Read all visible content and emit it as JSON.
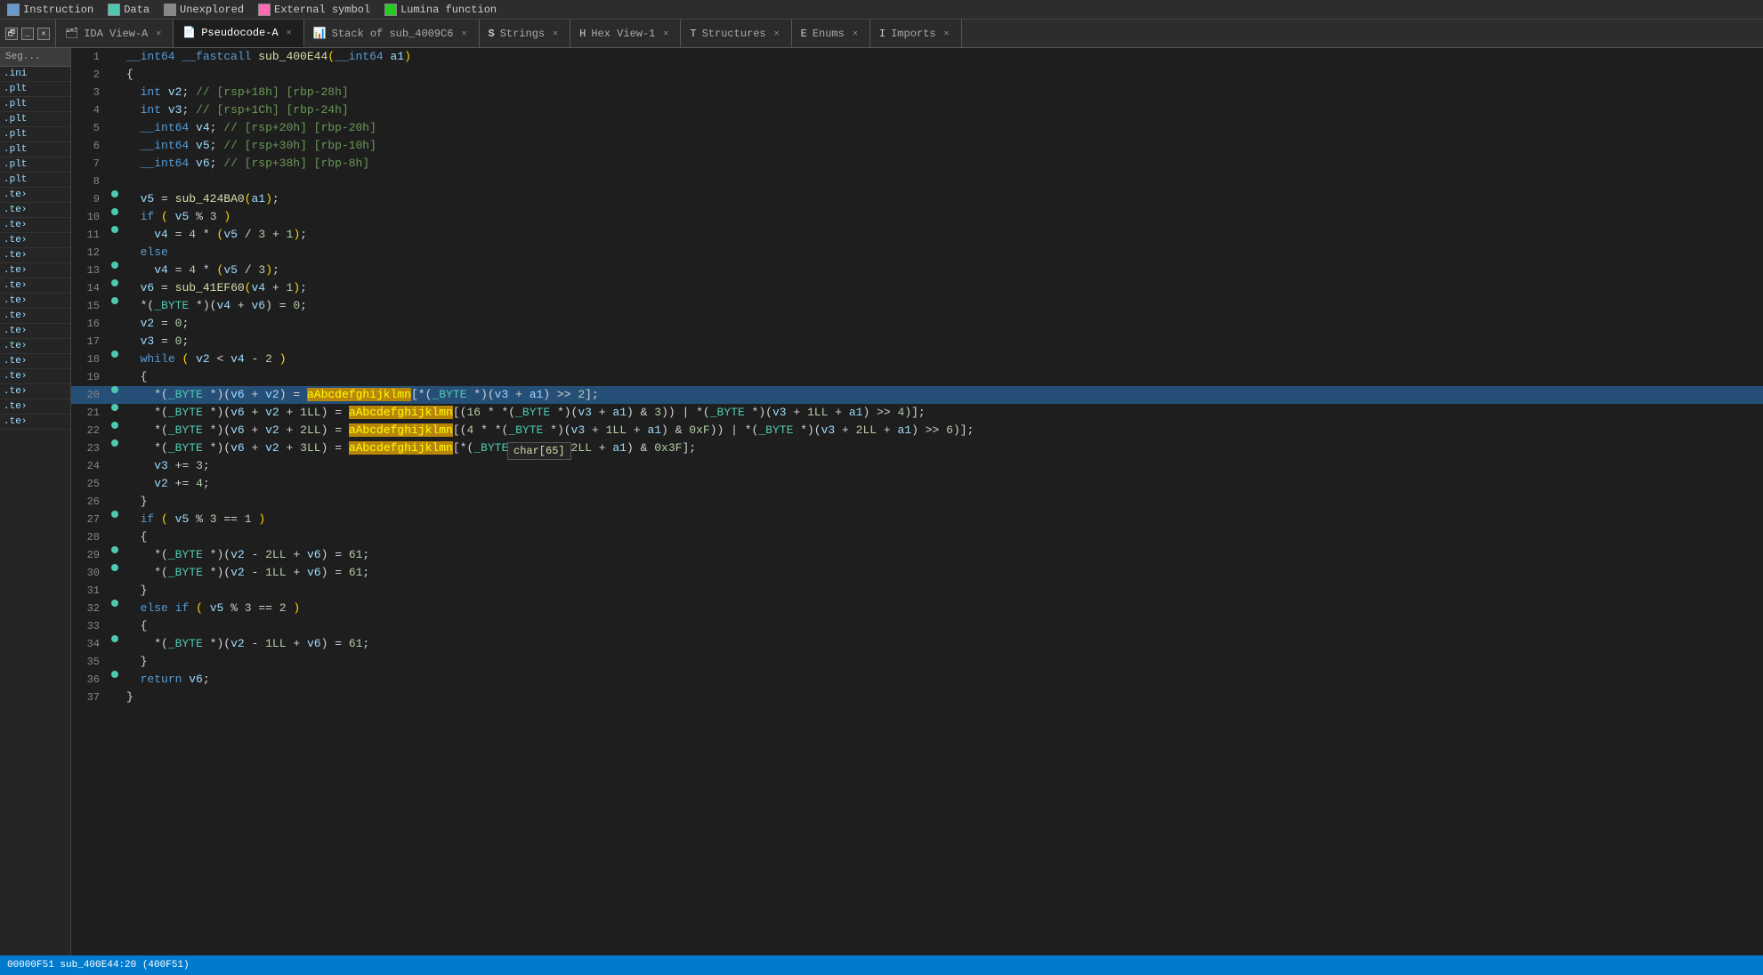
{
  "legend": {
    "items": [
      {
        "label": "Instruction",
        "color": "#6699cc",
        "type": "square"
      },
      {
        "label": "Data",
        "color": "#4ec9b0",
        "type": "square"
      },
      {
        "label": "Unexplored",
        "color": "#888888",
        "type": "square"
      },
      {
        "label": "External symbol",
        "color": "#ff69b4",
        "type": "square"
      },
      {
        "label": "Lumina function",
        "color": "#22cc22",
        "type": "square"
      }
    ]
  },
  "tabs": [
    {
      "label": "IDA View-A",
      "icon": "🗂",
      "active": false,
      "closable": true
    },
    {
      "label": "Pseudocode-A",
      "icon": "📄",
      "active": true,
      "closable": true
    },
    {
      "label": "Stack of sub_4009C6",
      "icon": "📊",
      "active": false,
      "closable": true
    },
    {
      "label": "Strings",
      "icon": "S",
      "active": false,
      "closable": true
    },
    {
      "label": "Hex View-1",
      "icon": "H",
      "active": false,
      "closable": true
    },
    {
      "label": "Structures",
      "icon": "T",
      "active": false,
      "closable": true
    },
    {
      "label": "Enums",
      "icon": "E",
      "active": false,
      "closable": true
    },
    {
      "label": "Imports",
      "icon": "I",
      "active": false,
      "closable": true
    }
  ],
  "sidebar": {
    "header": "Seg...",
    "items": [
      ".ini",
      ".plt",
      ".plt",
      ".plt",
      ".plt",
      ".plt",
      ".plt",
      ".plt",
      ".te›",
      ".te›",
      ".te›",
      ".te›",
      ".te›",
      ".te›",
      ".te›",
      ".te›",
      ".te›",
      ".te›",
      ".te›",
      ".te›",
      ".te›",
      ".te›",
      ".te›",
      ".te›"
    ]
  },
  "code": {
    "function_sig": "__int64 __fastcall sub_400E44(__int64 a1)",
    "lines": [
      {
        "num": 1,
        "dot": false,
        "text": "__int64 __fastcall sub_400E44(__int64 a1)",
        "type": "sig"
      },
      {
        "num": 2,
        "dot": false,
        "text": "{",
        "type": "normal"
      },
      {
        "num": 3,
        "dot": false,
        "text": "  int v2; // [rsp+18h] [rbp-28h]",
        "type": "comment"
      },
      {
        "num": 4,
        "dot": false,
        "text": "  int v3; // [rsp+1Ch] [rbp-24h]",
        "type": "comment"
      },
      {
        "num": 5,
        "dot": false,
        "text": "  __int64 v4; // [rsp+20h] [rbp-20h]",
        "type": "comment"
      },
      {
        "num": 6,
        "dot": false,
        "text": "  __int64 v5; // [rsp+30h] [rbp-10h]",
        "type": "comment"
      },
      {
        "num": 7,
        "dot": false,
        "text": "  __int64 v6; // [rsp+38h] [rbp-8h]",
        "type": "comment"
      },
      {
        "num": 8,
        "dot": false,
        "text": "",
        "type": "normal"
      },
      {
        "num": 9,
        "dot": true,
        "text": "  v5 = sub_424BA0(a1);",
        "type": "normal"
      },
      {
        "num": 10,
        "dot": true,
        "text": "  if ( v5 % 3 )",
        "type": "normal"
      },
      {
        "num": 11,
        "dot": true,
        "text": "    v4 = 4 * (v5 / 3 + 1);",
        "type": "normal"
      },
      {
        "num": 12,
        "dot": false,
        "text": "  else",
        "type": "normal"
      },
      {
        "num": 13,
        "dot": true,
        "text": "    v4 = 4 * (v5 / 3);",
        "type": "normal"
      },
      {
        "num": 14,
        "dot": true,
        "text": "  v6 = sub_41EF60(v4 + 1);",
        "type": "normal"
      },
      {
        "num": 15,
        "dot": true,
        "text": "  *(_BYTE *)(v4 + v6) = 0;",
        "type": "normal"
      },
      {
        "num": 16,
        "dot": false,
        "text": "  v2 = 0;",
        "type": "normal"
      },
      {
        "num": 17,
        "dot": false,
        "text": "  v3 = 0;",
        "type": "normal"
      },
      {
        "num": 18,
        "dot": true,
        "text": "  while ( v2 < v4 - 2 )",
        "type": "normal"
      },
      {
        "num": 19,
        "dot": false,
        "text": "  {",
        "type": "normal"
      },
      {
        "num": 20,
        "dot": true,
        "text": "    *(_BYTE *)(v6 + v2) = aAbcdefghijklmn[*(_BYTE *)(v3 + a1) >> 2];",
        "type": "highlight"
      },
      {
        "num": 21,
        "dot": true,
        "text": "    *(_BYTE *)(v6 + v2 + 1LL) = aAbcdefghijklmn[(16 * (*(_BYTE *)(v3 + a1) & 3)) | (*(_BYTE *)(v3 + 1LL + a1) >> 4)];",
        "type": "normal"
      },
      {
        "num": 22,
        "dot": true,
        "text": "    *(_BYTE *)(v6 + v2 + 2LL) = aAbcdefghijklmn[(4 * (*(_BYTE *)(v3 + 1LL + a1) & 0xF)) | (*(_BYTE *)(v3 + 2LL + a1) >> 6)];",
        "type": "normal"
      },
      {
        "num": 23,
        "dot": true,
        "text": "    *(_BYTE *)(v6 + v2 + 3LL) = aAbcdefghijklmn[*(_BYTE *)(v3 + 2LL + a1) & 0x3F];",
        "type": "normal"
      },
      {
        "num": 24,
        "dot": false,
        "text": "    v3 += 3;",
        "type": "normal"
      },
      {
        "num": 25,
        "dot": false,
        "text": "    v2 += 4;",
        "type": "normal"
      },
      {
        "num": 26,
        "dot": false,
        "text": "  }",
        "type": "normal"
      },
      {
        "num": 27,
        "dot": true,
        "text": "  if ( v5 % 3 == 1 )",
        "type": "normal"
      },
      {
        "num": 28,
        "dot": false,
        "text": "  {",
        "type": "normal"
      },
      {
        "num": 29,
        "dot": true,
        "text": "    *(_BYTE *)(v2 - 2LL + v6) = 61;",
        "type": "normal"
      },
      {
        "num": 30,
        "dot": true,
        "text": "    *(_BYTE *)(v2 - 1LL + v6) = 61;",
        "type": "normal"
      },
      {
        "num": 31,
        "dot": false,
        "text": "  }",
        "type": "normal"
      },
      {
        "num": 32,
        "dot": true,
        "text": "  else if ( v5 % 3 == 2 )",
        "type": "normal"
      },
      {
        "num": 33,
        "dot": false,
        "text": "  {",
        "type": "normal"
      },
      {
        "num": 34,
        "dot": true,
        "text": "    *(_BYTE *)(v2 - 1LL + v6) = 61;",
        "type": "normal"
      },
      {
        "num": 35,
        "dot": false,
        "text": "  }",
        "type": "normal"
      },
      {
        "num": 36,
        "dot": true,
        "text": "  return v6;",
        "type": "normal"
      },
      {
        "num": 37,
        "dot": false,
        "text": "}",
        "type": "normal"
      }
    ]
  },
  "status_bar": {
    "text": "00000F51 sub_400E44:20 (400F51)"
  },
  "tooltip": {
    "text": "char[65]",
    "visible": true
  }
}
